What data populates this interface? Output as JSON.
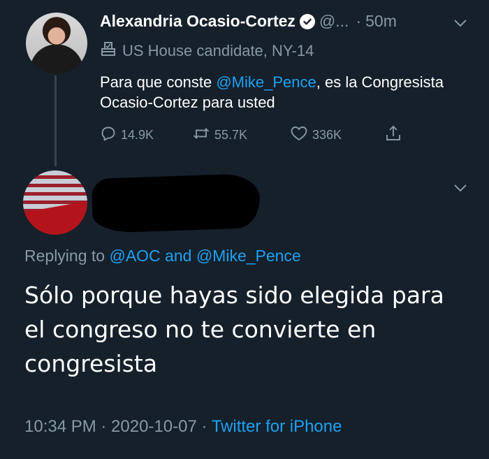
{
  "parent_tweet": {
    "display_name": "Alexandria Ocasio-Cortez",
    "handle": "@...",
    "separator": "·",
    "time": "50m",
    "label": "US House candidate, NY-14",
    "text_before": "Para que conste ",
    "mention": "@Mike_Pence",
    "text_after": ", es la Congresista Ocasio-Cortez para usted",
    "replies": "14.9K",
    "retweets": "55.7K",
    "likes": "336K"
  },
  "reply_tweet": {
    "replying_prefix": "Replying to ",
    "replying_to_1": "@AOC",
    "replying_and": " and ",
    "replying_to_2": "@Mike_Pence",
    "text": "Sólo porque hayas sido elegida para el congreso no te convierte en congresista",
    "timestamp": "10:34 PM · 2020-10-07 · ",
    "source": "Twitter for iPhone"
  },
  "colors": {
    "background": "#15202b",
    "secondary_text": "#8899a6",
    "accent": "#1da1f2"
  }
}
